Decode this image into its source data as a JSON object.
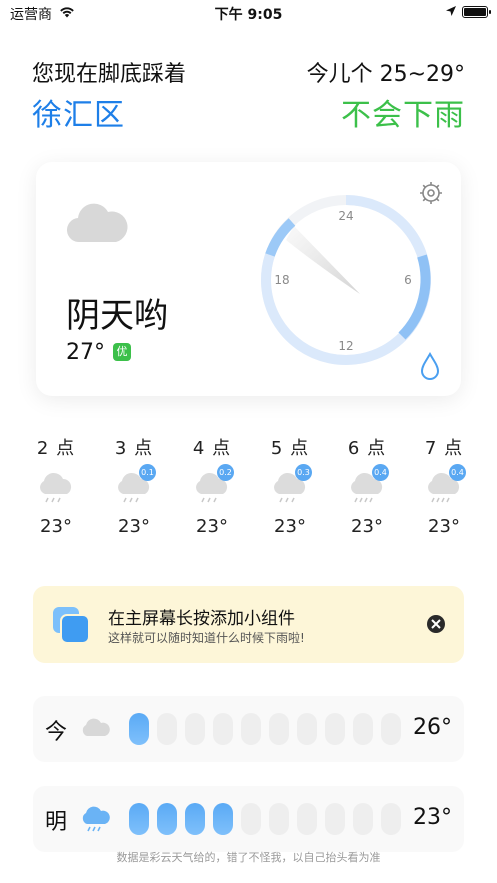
{
  "status_bar": {
    "carrier": "运营商",
    "time": "下午 9:05"
  },
  "header": {
    "location_prefix": "您现在脚底踩着",
    "location": "徐汇区",
    "temp_range": "今儿个 25~29°",
    "rain_verdict": "不会下雨"
  },
  "current": {
    "condition": "阴天哟",
    "temperature": "27°",
    "aqi_label": "优",
    "dial_labels": {
      "top": "24",
      "right": "6",
      "bottom": "12",
      "left": "18"
    }
  },
  "hourly": [
    {
      "label": "2 点",
      "temp": "23°",
      "rain": ""
    },
    {
      "label": "3 点",
      "temp": "23°",
      "rain": "0.1"
    },
    {
      "label": "4 点",
      "temp": "23°",
      "rain": "0.2"
    },
    {
      "label": "5 点",
      "temp": "23°",
      "rain": "0.3"
    },
    {
      "label": "6 点",
      "temp": "23°",
      "rain": "0.4"
    },
    {
      "label": "7 点",
      "temp": "23°",
      "rain": "0.4"
    }
  ],
  "banner": {
    "title": "在主屏幕长按添加小组件",
    "subtitle": "这样就可以随时知道什么时候下雨啦!"
  },
  "days": [
    {
      "label": "今",
      "temp": "26°",
      "icon": "cloud-icon",
      "rain_segments_on": 1,
      "rain_segments_total": 10
    },
    {
      "label": "明",
      "temp": "23°",
      "icon": "rain-cloud-icon",
      "rain_segments_on": 4,
      "rain_segments_total": 10
    }
  ],
  "footer": "数据是彩云天气给的，错了不怪我，以自己抬头看为准",
  "colors": {
    "blue": "#1e7fe8",
    "green": "#3cc04a",
    "banner_bg": "#fdf6d8",
    "rain_blue": "#5aa8f2"
  }
}
